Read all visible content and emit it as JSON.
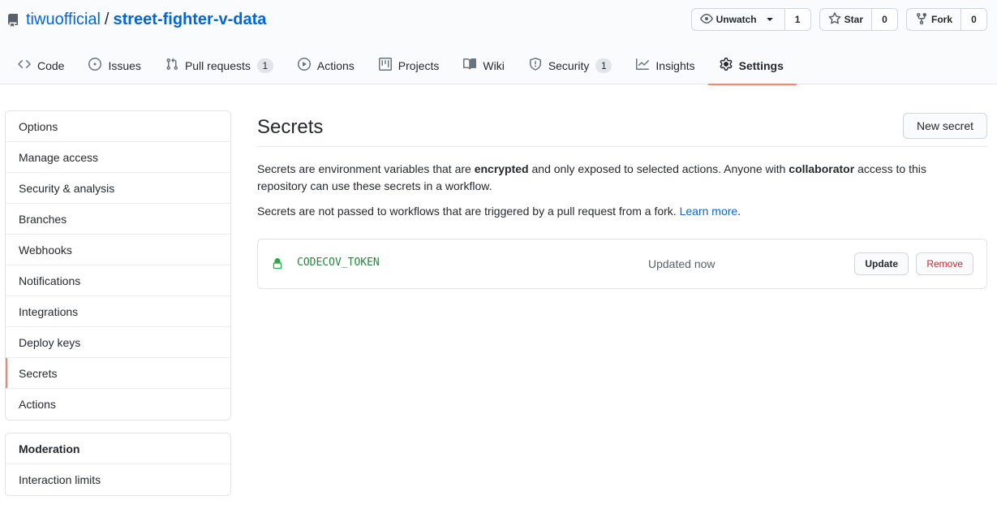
{
  "repo": {
    "owner": "tiwuofficial",
    "separator": "/",
    "name": "street-fighter-v-data"
  },
  "actions": {
    "watch": {
      "label": "Unwatch",
      "count": "1"
    },
    "star": {
      "label": "Star",
      "count": "0"
    },
    "fork": {
      "label": "Fork",
      "count": "0"
    }
  },
  "tabs": [
    {
      "label": "Code",
      "icon": "code-icon"
    },
    {
      "label": "Issues",
      "icon": "issue-icon"
    },
    {
      "label": "Pull requests",
      "icon": "pull-request-icon",
      "counter": "1"
    },
    {
      "label": "Actions",
      "icon": "play-icon"
    },
    {
      "label": "Projects",
      "icon": "project-icon"
    },
    {
      "label": "Wiki",
      "icon": "book-icon"
    },
    {
      "label": "Security",
      "icon": "shield-icon",
      "counter": "1"
    },
    {
      "label": "Insights",
      "icon": "graph-icon"
    },
    {
      "label": "Settings",
      "icon": "gear-icon",
      "selected": true
    }
  ],
  "sidebar": {
    "items": [
      {
        "label": "Options"
      },
      {
        "label": "Manage access"
      },
      {
        "label": "Security & analysis"
      },
      {
        "label": "Branches"
      },
      {
        "label": "Webhooks"
      },
      {
        "label": "Notifications"
      },
      {
        "label": "Integrations"
      },
      {
        "label": "Deploy keys"
      },
      {
        "label": "Secrets",
        "selected": true
      },
      {
        "label": "Actions"
      }
    ],
    "moderation": {
      "heading": "Moderation",
      "items": [
        {
          "label": "Interaction limits"
        }
      ]
    }
  },
  "main": {
    "title": "Secrets",
    "new_secret_label": "New secret",
    "desc1": {
      "t1": "Secrets are environment variables that are ",
      "b1": "encrypted",
      "t2": " and only exposed to selected actions. Anyone with ",
      "b2": "collaborator",
      "t3": " access to this repository can use these secrets in a workflow."
    },
    "desc2": {
      "t1": "Secrets are not passed to workflows that are triggered by a pull request from a fork. ",
      "link": "Learn more",
      "t2": "."
    },
    "secrets": [
      {
        "name": "CODECOV_TOKEN",
        "updated": "Updated now",
        "update_label": "Update",
        "remove_label": "Remove"
      }
    ]
  },
  "colors": {
    "link": "#0366d6",
    "accent": "#f9826c",
    "secret_name": "#22863a",
    "danger": "#cb2431"
  }
}
